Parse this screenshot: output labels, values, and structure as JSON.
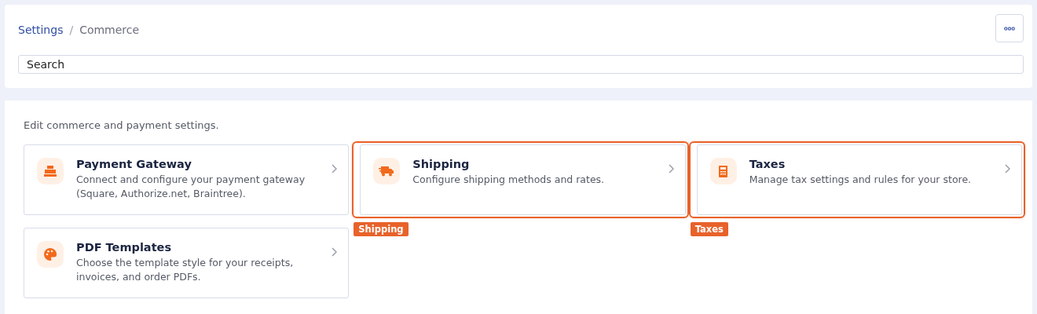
{
  "breadcrumb": [
    {
      "label": "Settings",
      "link": true
    },
    {
      "label": "Commerce",
      "link": false
    }
  ],
  "breadcrumb_separator": "/",
  "search": {
    "placeholder": "Search"
  },
  "intro": "Edit commerce and payment settings.",
  "cards": [
    {
      "kind": "register",
      "title": "Payment Gateway",
      "description": "Connect and configure your payment gateway (Square, Authorize.net, Braintree).",
      "highlighted": false
    },
    {
      "kind": "truck",
      "title": "Shipping",
      "description": "Configure shipping methods and rates.",
      "highlighted": true,
      "highlight_label": "Shipping"
    },
    {
      "kind": "calculator",
      "title": "Taxes",
      "description": "Manage tax settings and rules for your store.",
      "highlighted": true,
      "highlight_label": "Taxes"
    },
    {
      "kind": "palette",
      "title": "PDF Templates",
      "description": "Choose the template style for your receipts, invoices, and order PDFs.",
      "highlighted": false
    }
  ]
}
